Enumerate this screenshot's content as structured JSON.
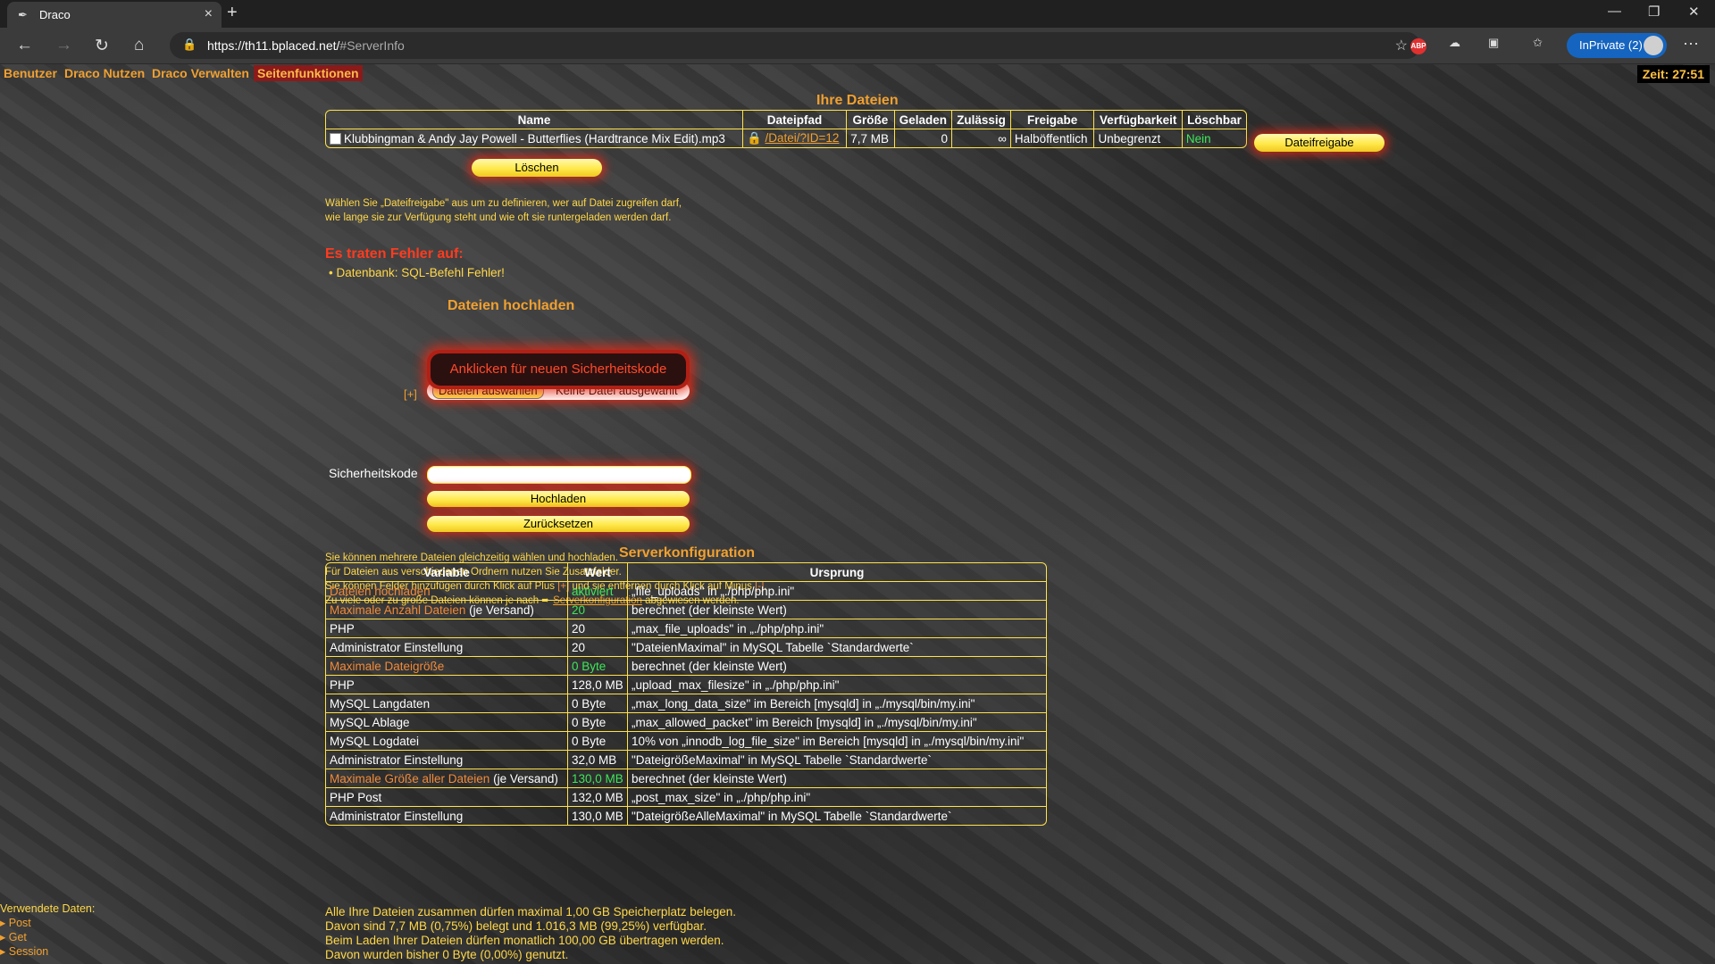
{
  "browser": {
    "tab_title": "Draco",
    "url_main": "https://th11.bplaced.net/",
    "url_hash": "#ServerInfo",
    "inprivate_label": "InPrivate (2)"
  },
  "nav": {
    "items": [
      "Benutzer",
      "Draco Nutzen",
      "Draco Verwalten",
      "Seitenfunktionen"
    ],
    "clock": "Zeit: 27:51"
  },
  "files": {
    "title": "Ihre Dateien",
    "headers": [
      "Name",
      "Dateipfad",
      "Größe",
      "Geladen",
      "Zulässig",
      "Freigabe",
      "Verfügbarkeit",
      "Löschbar"
    ],
    "row": {
      "name": "Klubbingman & Andy Jay Powell - Butterflies (Hardtrance Mix Edit).mp3",
      "path": "/Datei/?ID=12",
      "size": "7,7 MB",
      "loaded": "0",
      "allowed": "∞",
      "share": "Halböffentlich",
      "availability": "Unbegrenzt",
      "deletable": "Nein"
    },
    "share_button": "Dateifreigabe",
    "delete_button": "Löschen",
    "note1": "Wählen Sie „Dateifreigabe\" aus um zu definieren, wer auf Datei zugreifen darf,",
    "note2": "wie lange sie zur Verfügung steht und wie oft sie runtergeladen werden darf."
  },
  "errors": {
    "title": "Es traten Fehler auf:",
    "item": "Datenbank: SQL-Befehl Fehler!"
  },
  "upload": {
    "title": "Dateien hochladen",
    "plus": "[+]",
    "choose_button": "Dateien auswählen",
    "no_file": "Keine Datei ausgewählt",
    "captcha": "Anklicken für neuen Sicherheitskode",
    "security_label": "Sicherheitskode",
    "security_value": "",
    "upload_button": "Hochladen",
    "reset_button": "Zurücksetzen",
    "note1": "Sie können mehrere Dateien gleichzeitig wählen und hochladen.",
    "note2": "Für Dateien aus verschiedenen Ordnern nutzen Sie Zusatzfelder.",
    "note3a": "Sie können Felder hinzufügen durch Klick auf Plus",
    "note3_plus": "[+]",
    "note3b": "und sie entfernen durch Klick auf Minus",
    "note3_minus": "[-]",
    "note3c": ".",
    "note4a": "Zu viele oder zu große Dateien können je nach",
    "note4_link": "Serverkonfiguration",
    "note4b": "abgewiesen werden."
  },
  "server": {
    "title": "Serverkonfiguration",
    "headers": [
      "Variable",
      "Wert",
      "Ursprung"
    ],
    "rows": [
      {
        "var": "Dateien hochladen",
        "var_suffix": "",
        "value": "aktiviert",
        "origin": "„file_uploads\" in „./php/php.ini\"",
        "hl": true
      },
      {
        "var": "Maximale Anzahl Dateien",
        "var_suffix": " (je Versand)",
        "value": "20",
        "origin": "berechnet (der kleinste Wert)",
        "hl": true
      },
      {
        "var": "PHP",
        "var_suffix": "",
        "value": "20",
        "origin": "„max_file_uploads\" in „./php/php.ini\"",
        "hl": false
      },
      {
        "var": "Administrator Einstellung",
        "var_suffix": "",
        "value": "20",
        "origin": "\"DateienMaximal\" in MySQL Tabelle `Standardwerte`",
        "hl": false
      },
      {
        "var": "Maximale Dateigröße",
        "var_suffix": "",
        "value": "0 Byte",
        "origin": "berechnet (der kleinste Wert)",
        "hl": true
      },
      {
        "var": "PHP",
        "var_suffix": "",
        "value": "128,0 MB",
        "origin": "„upload_max_filesize\" in „./php/php.ini\"",
        "hl": false
      },
      {
        "var": "MySQL Langdaten",
        "var_suffix": "",
        "value": "0 Byte",
        "origin": "„max_long_data_size\" im Bereich [mysqld] in „./mysql/bin/my.ini\"",
        "hl": false
      },
      {
        "var": "MySQL Ablage",
        "var_suffix": "",
        "value": "0 Byte",
        "origin": "„max_allowed_packet\" im Bereich [mysqld] in „./mysql/bin/my.ini\"",
        "hl": false
      },
      {
        "var": "MySQL Logdatei",
        "var_suffix": "",
        "value": "0 Byte",
        "origin": "10% von „innodb_log_file_size\" im Bereich [mysqld] in „./mysql/bin/my.ini\"",
        "hl": false
      },
      {
        "var": "Administrator Einstellung",
        "var_suffix": "",
        "value": "32,0 MB",
        "origin": "\"DateigrößeMaximal\" in MySQL Tabelle `Standardwerte`",
        "hl": false
      },
      {
        "var": "Maximale Größe aller Dateien",
        "var_suffix": " (je Versand)",
        "value": "130,0 MB",
        "origin": "berechnet (der kleinste Wert)",
        "hl": true
      },
      {
        "var": "PHP Post",
        "var_suffix": "",
        "value": "132,0 MB",
        "origin": "„post_max_size\" in „./php/php.ini\"",
        "hl": false
      },
      {
        "var": "Administrator Einstellung",
        "var_suffix": "",
        "value": "130,0 MB",
        "origin": "\"DateigrößeAlleMaximal\" in MySQL Tabelle `Standardwerte`",
        "hl": false
      }
    ]
  },
  "summary": [
    "Alle Ihre Dateien zusammen dürfen maximal 1,00 GB Speicherplatz belegen.",
    "Davon sind 7,7 MB (0,75%) belegt und 1.016,3 MB (99,25%) verfügbar.",
    "Beim Laden Ihrer Dateien dürfen monatlich 100,00 GB übertragen werden.",
    "Davon wurden bisher 0 Byte (0,00%) genutzt."
  ],
  "footer": {
    "label": "Verwendete Daten:",
    "items": [
      "Post",
      "Get",
      "Session"
    ]
  },
  "colors": {
    "accent": "#f0a030",
    "highlight": "#f08a3a",
    "active_value": "#3ee65a",
    "error": "#ff3b1f",
    "border": "#ffe24a",
    "button_glow": "#e62814"
  }
}
